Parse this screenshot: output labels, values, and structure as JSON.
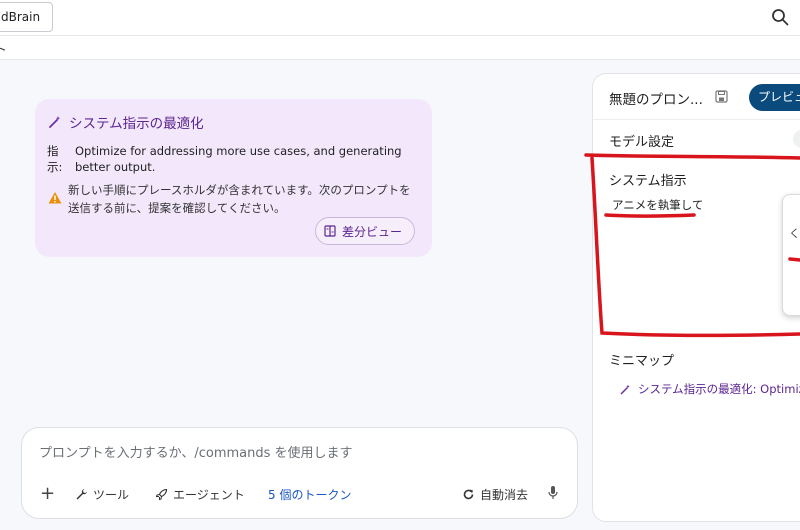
{
  "topbar": {
    "brand": "dBrain",
    "search_icon": "search-icon"
  },
  "subbar": {
    "text": "ト"
  },
  "notice": {
    "title": "システム指示の最適化",
    "instruction_label": "指示:",
    "instruction_text": "Optimize for addressing more use cases, and generating better output.",
    "warning_text": "新しい手順にプレースホルダが含まれています。次のプロンプトを送信する前に、提案を確認してください。",
    "diff_button": "差分ビュー"
  },
  "prompt": {
    "placeholder": "プロンプトを入力するか、/commands を使用します",
    "plus": "+",
    "tools_label": "ツール",
    "agent_label": "エージェント",
    "tokens_label": "5 個のトークン",
    "auto_delete_label": "自動消去"
  },
  "panel": {
    "title": "無題のプロン...",
    "preview_button": "プレビュー",
    "model_settings_label": "モデル設定",
    "system_instructions_label": "システム指示",
    "system_instructions_value": "アニメを執筆して",
    "popup_glyph": "く",
    "minimap_label": "ミニマップ",
    "minimap_item": "システム指示の最適化: Optimize"
  },
  "colors": {
    "accent_purple": "#5b2590",
    "notice_bg": "#f3e8fb",
    "preview_bg": "#0b4a7d",
    "token_blue": "#1a56c4",
    "annotation_red": "#d8141c"
  }
}
